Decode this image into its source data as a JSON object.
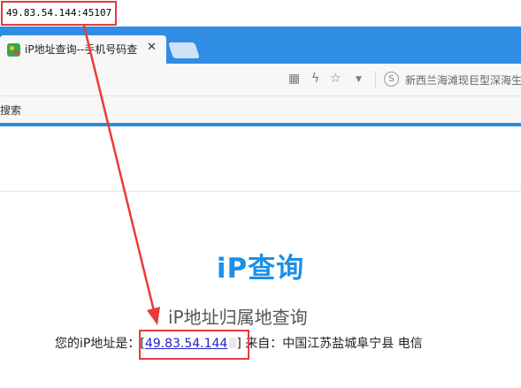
{
  "annotation": {
    "proxy_address": "49.83.54.144:45107"
  },
  "browser": {
    "tab_title": "iP地址查询--手机号码查",
    "close_glyph": "✕",
    "news_ticker": "新西兰海滩现巨型深海生",
    "bookmark_label": "搜索"
  },
  "page": {
    "logo": "iP查询",
    "subtitle": "iP地址归属地查询",
    "ip_prefix": "您的iP地址是：",
    "ip_open_bracket": "[",
    "ip_value": "49.83.54.144",
    "ip_close_bracket": "]",
    "ip_from": " 来自：中国江苏盐城阜宁县 电信"
  },
  "colors": {
    "tab_bar": "#2f8de4",
    "accent_line": "#2b8fdf",
    "logo": "#1c8fe8",
    "annotation_red": "#e83a3a",
    "link": "#2222cc"
  },
  "icons": [
    "qr-code-icon",
    "lightning-icon",
    "star-icon",
    "dropdown-icon",
    "s-logo-icon"
  ]
}
